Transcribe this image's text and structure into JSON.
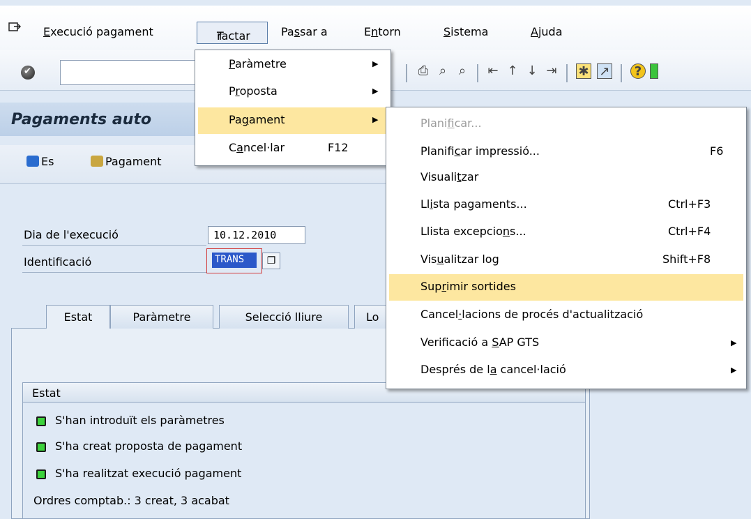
{
  "menubar": {
    "items": [
      {
        "pre": "",
        "u": "E",
        "post": "xecució pagament"
      },
      {
        "pre": "",
        "u": "T",
        "post": "ractar"
      },
      {
        "pre": "Pa",
        "u": "s",
        "post": "sar a"
      },
      {
        "pre": "E",
        "u": "n",
        "post": "torn"
      },
      {
        "pre": "",
        "u": "S",
        "post": "istema"
      },
      {
        "pre": "",
        "u": "A",
        "post": "juda"
      }
    ]
  },
  "page": {
    "title": "Pagaments auto",
    "app_toolbar": {
      "es_label": "Es",
      "pagament_label": "Pagament"
    }
  },
  "form": {
    "date_label": "Dia de l'execució",
    "date_value": "10.12.2010",
    "id_label": "Identificació",
    "id_value": "TRANS"
  },
  "tabs": [
    "Estat",
    "Paràmetre",
    "Selecció lliure",
    "Lo"
  ],
  "status": {
    "title": "Estat",
    "lines": [
      "S'han introduït els paràmetres",
      "S'ha creat proposta de pagament",
      "S'ha realitzat execució pagament"
    ],
    "summary": "Ordres comptab.: 3 creat, 3 acabat"
  },
  "tractar_menu": {
    "items": [
      {
        "pre": "",
        "u": "P",
        "post": "aràmetre",
        "shortcut": ""
      },
      {
        "pre": "P",
        "u": "r",
        "post": "oposta",
        "shortcut": ""
      },
      {
        "pre": "Pa",
        "u": "g",
        "post": "ament",
        "shortcut": ""
      },
      {
        "pre": "C",
        "u": "a",
        "post": "ncel·lar",
        "shortcut": "F12"
      }
    ]
  },
  "pagament_submenu": {
    "items": [
      {
        "pre": "Plani",
        "u": "f",
        "post": "icar...",
        "shortcut": ""
      },
      {
        "pre": "Planifi",
        "u": "c",
        "post": "ar impressió...",
        "shortcut": "F6"
      },
      {
        "pre": "Visuali",
        "u": "t",
        "post": "zar",
        "shortcut": ""
      },
      {
        "pre": "Ll",
        "u": "i",
        "post": "sta pagaments...",
        "shortcut": "Ctrl+F3"
      },
      {
        "pre": "Llista excepcio",
        "u": "n",
        "post": "s...",
        "shortcut": "Ctrl+F4"
      },
      {
        "pre": "Vis",
        "u": "u",
        "post": "alitzar log",
        "shortcut": "Shift+F8"
      },
      {
        "pre": "Sup",
        "u": "r",
        "post": "imir sortides",
        "shortcut": ""
      },
      {
        "pre": "Cancel",
        "u": "·",
        "post": "lacions de procés d'actualització",
        "shortcut": ""
      },
      {
        "pre": "Verificació a ",
        "u": "S",
        "post": "AP GTS",
        "shortcut": ""
      },
      {
        "pre": "Després de l",
        "u": "a",
        "post": " cancel·lació",
        "shortcut": ""
      }
    ]
  },
  "colors": {
    "highlight": "#fde7a0",
    "led": "#3cd23c",
    "selection": "#2b58c9"
  }
}
